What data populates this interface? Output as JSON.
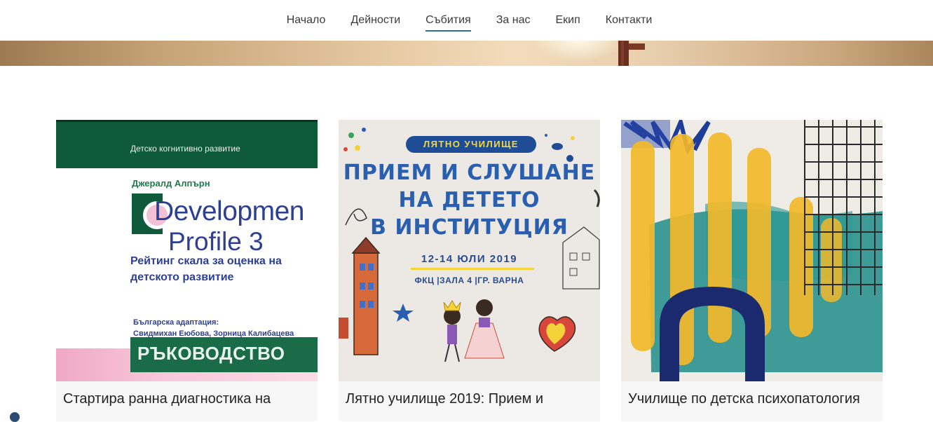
{
  "nav": {
    "items": [
      {
        "label": "Начало"
      },
      {
        "label": "Дейности"
      },
      {
        "label": "Събития",
        "active": true
      },
      {
        "label": "За нас"
      },
      {
        "label": "Екип"
      },
      {
        "label": "Контакти"
      }
    ],
    "accent_color": "#2c6f9b"
  },
  "cards": [
    {
      "caption": "Стартира ранна диагностика на",
      "image": {
        "series": "Детско когнитивно развитие",
        "author": "Джералд Алпърн",
        "title_line1": "Developmen",
        "title_line2": "Profile 3",
        "subtitle_line1": "Рейтинг скала за оценка на",
        "subtitle_line2": "детското развитие",
        "adaptation_line1": "Българска адаптация:",
        "adaptation_line2": "Свидмихан Еюбова, Зорница Калибацева",
        "band": "РЪКОВОДСТВО"
      }
    },
    {
      "caption": "Лятно училище 2019: Прием и",
      "image": {
        "pill": "ЛЯТНО УЧИЛИЩЕ",
        "headline_line1": "ПРИЕМ И СЛУШАНЕ",
        "headline_line2": "НА ДЕТЕТО",
        "headline_line3": "В ИНСТИТУЦИЯ",
        "dates": "12-14 ЮЛИ 2019",
        "venue": "ФКЦ |ЗАЛА 4 |ГР. ВАРНА"
      }
    },
    {
      "caption": "Училище по детска психопатология",
      "image": {
        "icon": "abstract-painting"
      }
    }
  ]
}
